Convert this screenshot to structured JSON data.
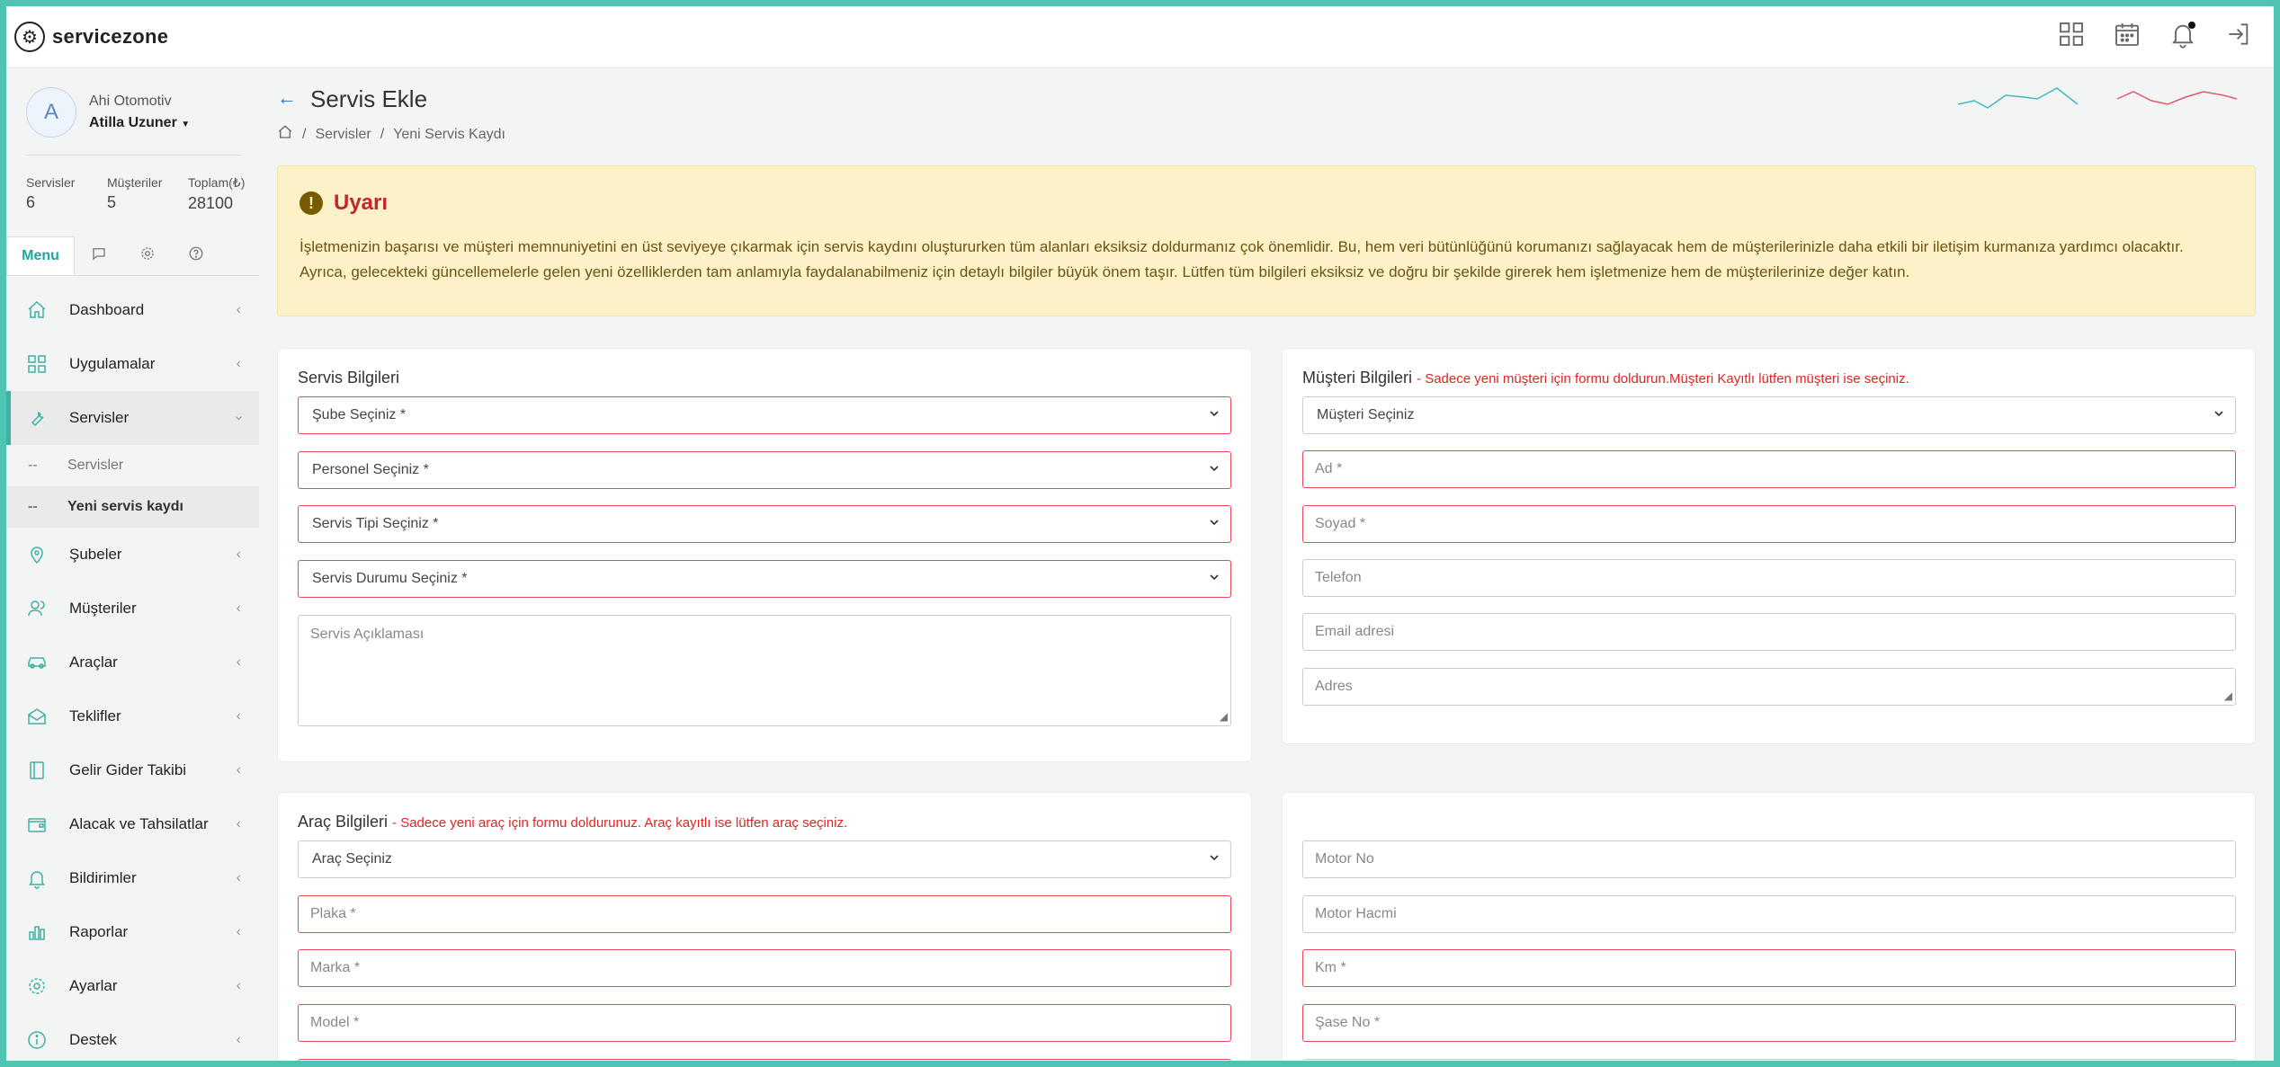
{
  "app": {
    "brand": "servicezone"
  },
  "sidebar": {
    "company": "Ahi Otomotiv",
    "user": "Atilla Uzuner",
    "avatar_letter": "A",
    "stats": [
      {
        "label": "Servisler",
        "value": "6"
      },
      {
        "label": "Müşteriler",
        "value": "5"
      },
      {
        "label": "Toplam(₺)",
        "value": "28100"
      }
    ],
    "tabs": {
      "menu": "Menu"
    },
    "menu": [
      {
        "label": "Dashboard",
        "icon": "home-icon"
      },
      {
        "label": "Uygulamalar",
        "icon": "grid-icon"
      },
      {
        "label": "Servisler",
        "icon": "wrench-icon"
      },
      {
        "label": "Şubeler",
        "icon": "map-pin-icon"
      },
      {
        "label": "Müşteriler",
        "icon": "users-icon"
      },
      {
        "label": "Araçlar",
        "icon": "car-icon"
      },
      {
        "label": "Teklifler",
        "icon": "envelope-open-icon"
      },
      {
        "label": "Gelir Gider Takibi",
        "icon": "book-icon"
      },
      {
        "label": "Alacak ve Tahsilatlar",
        "icon": "wallet-icon"
      },
      {
        "label": "Bildirimler",
        "icon": "bell-icon"
      },
      {
        "label": "Raporlar",
        "icon": "bar-chart-icon"
      },
      {
        "label": "Ayarlar",
        "icon": "gear-icon"
      },
      {
        "label": "Destek",
        "icon": "info-icon"
      }
    ],
    "submenu": [
      {
        "dash": "--",
        "label": "Servisler"
      },
      {
        "dash": "--",
        "label": "Yeni servis kaydı"
      }
    ]
  },
  "page": {
    "title": "Servis Ekle",
    "breadcrumb": [
      "Servisler",
      "Yeni Servis Kaydı"
    ],
    "separator": "/"
  },
  "alert": {
    "title": "Uyarı",
    "icon_char": "!",
    "text": "İşletmenizin başarısı ve müşteri memnuniyetini en üst seviyeye çıkarmak için servis kaydını oluştururken tüm alanları eksiksiz doldurmanız çok önemlidir. Bu, hem veri bütünlüğünü korumanızı sağlayacak hem de müşterilerinizle daha etkili bir iletişim kurmanıza yardımcı olacaktır. Ayrıca, gelecekteki güncellemelerle gelen yeni özelliklerden tam anlamıyla faydalanabilmeniz için detaylı bilgiler büyük önem taşır. Lütfen tüm bilgileri eksiksiz ve doğru bir şekilde girerek hem işletmenize hem de müşterilerinize değer katın."
  },
  "servis": {
    "title": "Servis Bilgileri",
    "sube": "Şube Seçiniz *",
    "personel": "Personel Seçiniz *",
    "tip": "Servis Tipi Seçiniz *",
    "durum": "Servis Durumu Seçiniz *",
    "aciklama_placeholder": "Servis Açıklaması"
  },
  "musteri": {
    "title": "Müşteri Bilgileri",
    "hint": "- Sadece yeni müşteri için formu doldurun.Müşteri Kayıtlı lütfen müşteri ise seçiniz.",
    "select": "Müşteri Seçiniz",
    "ad": "Ad *",
    "soyad": "Soyad *",
    "telefon": "Telefon",
    "email": "Email adresi",
    "adres": "Adres"
  },
  "arac": {
    "title": "Araç Bilgileri",
    "hint": "- Sadece yeni araç için formu doldurunuz. Araç kayıtlı ise lütfen araç seçiniz.",
    "select": "Araç Seçiniz",
    "plaka": "Plaka *",
    "marka": "Marka *",
    "model": "Model *",
    "motor_no": "Motor No",
    "motor_hacmi": "Motor Hacmi",
    "km": "Km *",
    "sase_no": "Şase No *"
  },
  "colors": {
    "accent": "#3fb0a3",
    "required_border": "#e84b57",
    "hint": "#e02424",
    "alert_bg": "#fdf1c7"
  }
}
